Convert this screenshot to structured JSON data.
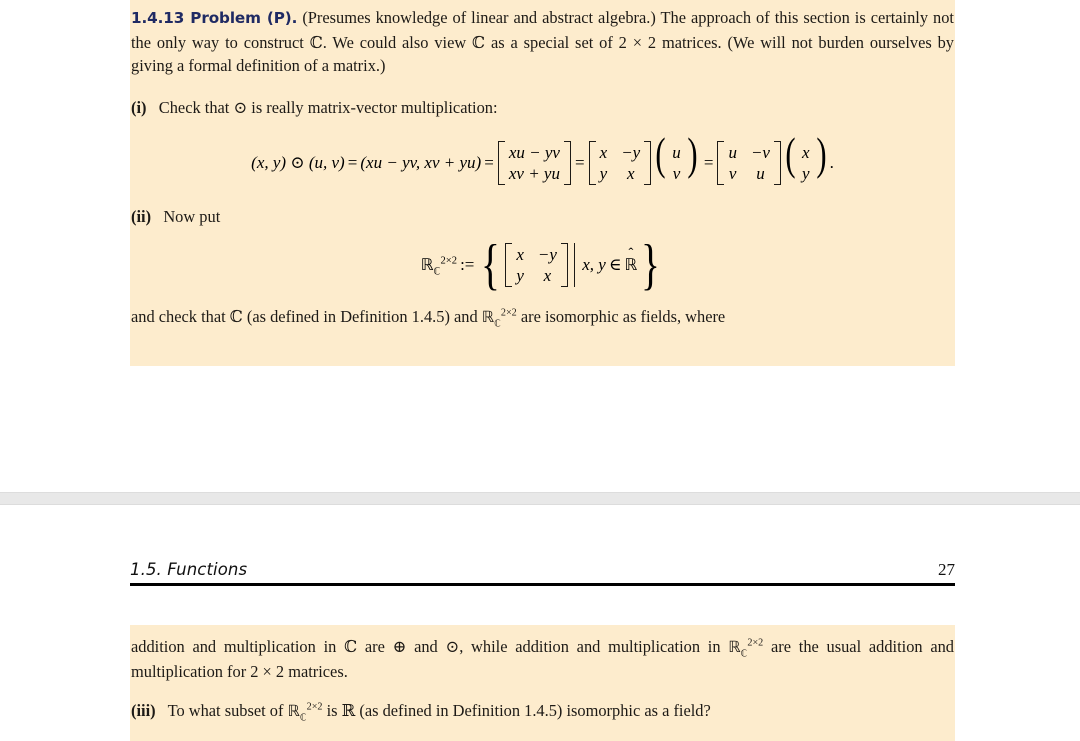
{
  "document": {
    "background_color": "#ffffff",
    "page_color": "#fdeccd",
    "heading_color": "#1f2a63",
    "text_color": "#1d1a16"
  },
  "running_header": {
    "section": "1.5.  Functions",
    "page_number": "27"
  },
  "top_page": {
    "problem": {
      "number": "1.4.13",
      "label": "Problem (P).",
      "heading_full": "1.4.13 Problem (P).",
      "intro": "(Presumes knowledge of linear and abstract algebra.) The approach of this section is certainly not the only way to construct ℂ. We could also view ℂ as a special set of 2 × 2 matrices. (We will not burden ourselves by giving a formal definition of a matrix.)"
    },
    "part_i": {
      "marker": "(i)",
      "text": "Check that ⊙ is really matrix-vector multiplication:"
    },
    "equation_multiplication": {
      "lhs": "(x, y) ⊙ (u, v)",
      "equals": "=",
      "tuple_result": "(xu − yv, xv + yu)",
      "matrix_column": {
        "row1": "xu − yv",
        "row2": "xv + yu"
      },
      "matrix_xy": {
        "r1c1": "x",
        "r1c2": "−y",
        "r2c1": "y",
        "r2c2": "x"
      },
      "vector_uv": {
        "row1": "u",
        "row2": "v"
      },
      "matrix_uv": {
        "r1c1": "u",
        "r1c2": "−v",
        "r2c1": "v",
        "r2c2": "u"
      },
      "vector_xy": {
        "row1": "x",
        "row2": "y"
      },
      "terminator": "."
    },
    "part_ii": {
      "marker": "(ii)",
      "text": "Now put"
    },
    "equation_rc_definition": {
      "symbol_base": "ℝ",
      "symbol_subscript": "ℂ",
      "symbol_superscript": "2×2",
      "assign": ":=",
      "matrix": {
        "r1c1": "x",
        "r1c2": "−y",
        "r2c1": "y",
        "r2c2": "x"
      },
      "condition": "x, y ∈ ℝ̂",
      "condition_vars": "x, y",
      "condition_member": "∈"
    },
    "closing_line": {
      "text_before": "and check that ℂ (as defined in Definition 1.4.5) and ",
      "text_after": " are isomorphic as fields, where"
    }
  },
  "bottom_page": {
    "paragraph_1": {
      "text_before": "addition and multiplication in ℂ are ⊕ and ⊙, while addition and multiplication in ",
      "text_after": " are the usual addition and multiplication for 2 × 2 matrices."
    },
    "part_iii": {
      "marker": "(iii)",
      "text_before": "To what subset of ",
      "text_after": " is ℝ (as defined in Definition 1.4.5) isomorphic as a field?"
    }
  },
  "symbols": {
    "blackboard_r": "ℝ",
    "blackboard_c": "ℂ",
    "superscript_2x2": "2×2",
    "hat": "ˆ",
    "odot": "⊙",
    "oplus": "⊕"
  }
}
